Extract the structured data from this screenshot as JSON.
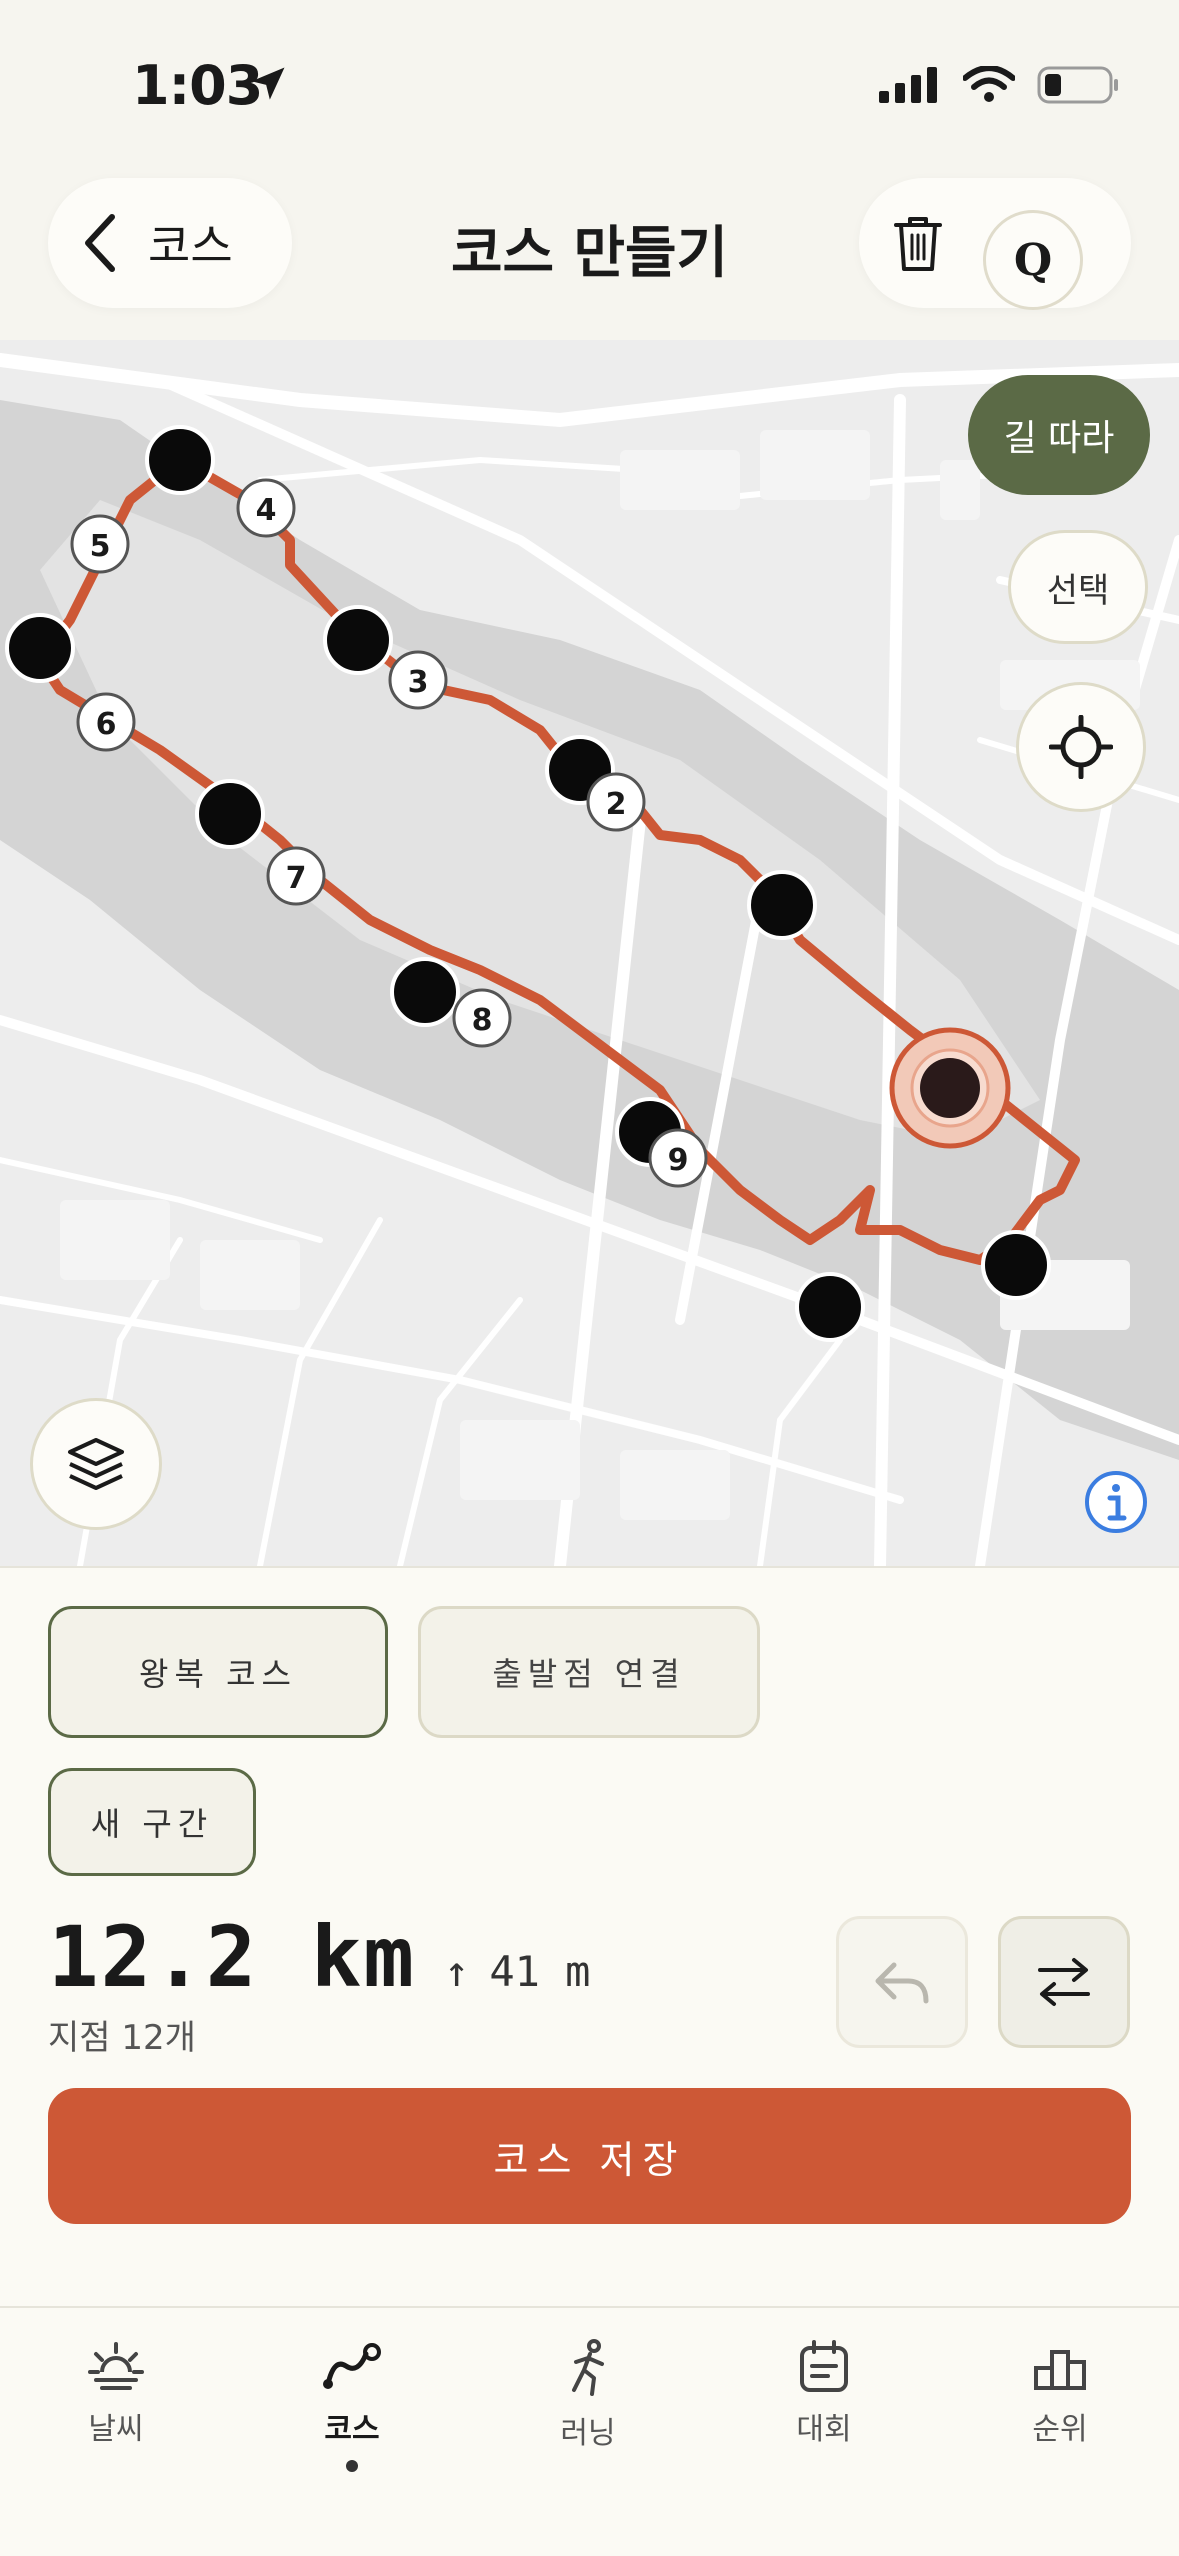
{
  "status_bar": {
    "time": "1:03"
  },
  "header": {
    "back_label": "코스",
    "title": "코스 만들기",
    "q_label": "Q"
  },
  "map": {
    "follow_road_label": "길 따라",
    "select_label": "선택",
    "waypoint_labels": [
      "2",
      "3",
      "4",
      "5",
      "6",
      "7",
      "8",
      "9"
    ],
    "colors": {
      "route": "#cd5836",
      "water": "#d4d4d4",
      "land": "#ededed",
      "follow_button": "#5b6a46"
    }
  },
  "panel": {
    "round_trip_label": "왕복 코스",
    "connect_start_label": "출발점 연결",
    "new_segment_label": "새 구간",
    "distance": "12.2 km",
    "elevation_arrow": "↑",
    "elevation": "41 m",
    "points_count": "지점 12개",
    "save_label": "코스 저장",
    "colors": {
      "save_button": "#cd5836"
    }
  },
  "tabs": [
    {
      "label": "날씨",
      "icon": "sun-icon"
    },
    {
      "label": "코스",
      "icon": "route-icon",
      "active": true
    },
    {
      "label": "러닝",
      "icon": "runner-icon"
    },
    {
      "label": "대회",
      "icon": "calendar-icon"
    },
    {
      "label": "순위",
      "icon": "podium-icon"
    }
  ]
}
